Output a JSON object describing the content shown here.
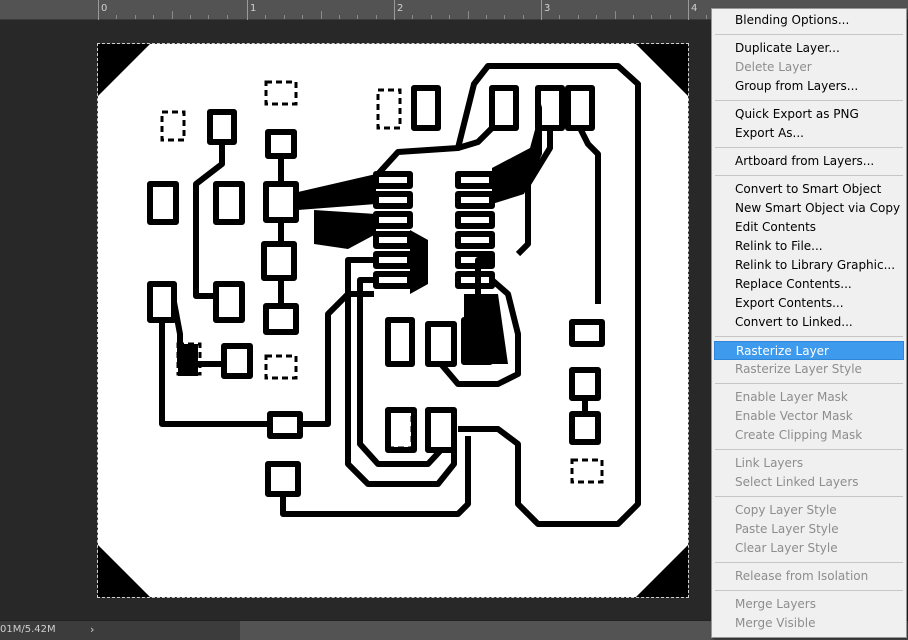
{
  "ruler": {
    "labels": [
      "0",
      "1",
      "2",
      "3",
      "4"
    ]
  },
  "status": {
    "doc_size": "01M/5.42M",
    "arrow": "›"
  },
  "menu": {
    "items": [
      {
        "label": "Blending Options...",
        "enabled": true
      },
      {
        "sep": true
      },
      {
        "label": "Duplicate Layer...",
        "enabled": true
      },
      {
        "label": "Delete Layer",
        "enabled": false
      },
      {
        "label": "Group from Layers...",
        "enabled": true
      },
      {
        "sep": true
      },
      {
        "label": "Quick Export as PNG",
        "enabled": true
      },
      {
        "label": "Export As...",
        "enabled": true
      },
      {
        "sep": true
      },
      {
        "label": "Artboard from Layers...",
        "enabled": true
      },
      {
        "sep": true
      },
      {
        "label": "Convert to Smart Object",
        "enabled": true
      },
      {
        "label": "New Smart Object via Copy",
        "enabled": true
      },
      {
        "label": "Edit Contents",
        "enabled": true
      },
      {
        "label": "Relink to File...",
        "enabled": true
      },
      {
        "label": "Relink to Library Graphic...",
        "enabled": true
      },
      {
        "label": "Replace Contents...",
        "enabled": true
      },
      {
        "label": "Export Contents...",
        "enabled": true
      },
      {
        "label": "Convert to Linked...",
        "enabled": true
      },
      {
        "sep": true
      },
      {
        "label": "Rasterize Layer",
        "enabled": true,
        "highlighted": true
      },
      {
        "label": "Rasterize Layer Style",
        "enabled": false
      },
      {
        "sep": true
      },
      {
        "label": "Enable Layer Mask",
        "enabled": false
      },
      {
        "label": "Enable Vector Mask",
        "enabled": false
      },
      {
        "label": "Create Clipping Mask",
        "enabled": false
      },
      {
        "sep": true
      },
      {
        "label": "Link Layers",
        "enabled": false
      },
      {
        "label": "Select Linked Layers",
        "enabled": false
      },
      {
        "sep": true
      },
      {
        "label": "Copy Layer Style",
        "enabled": false
      },
      {
        "label": "Paste Layer Style",
        "enabled": false
      },
      {
        "label": "Clear Layer Style",
        "enabled": false
      },
      {
        "sep": true
      },
      {
        "label": "Release from Isolation",
        "enabled": false
      },
      {
        "sep": true
      },
      {
        "label": "Merge Layers",
        "enabled": false
      },
      {
        "label": "Merge Visible",
        "enabled": false
      }
    ]
  },
  "colors": {
    "highlight": "#3d9aed",
    "disabled_text": "#8d8d8d",
    "pcb_trace": "#000000",
    "canvas_bg": "#282828"
  }
}
